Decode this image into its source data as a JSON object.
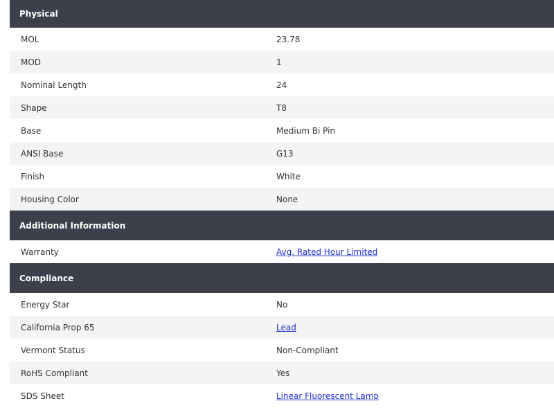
{
  "sections": [
    {
      "title": "Physical",
      "rows": [
        {
          "label": "MOL",
          "value": "23.78"
        },
        {
          "label": "MOD",
          "value": "1"
        },
        {
          "label": "Nominal Length",
          "value": "24"
        },
        {
          "label": "Shape",
          "value": "T8"
        },
        {
          "label": "Base",
          "value": "Medium Bi Pin"
        },
        {
          "label": "ANSI Base",
          "value": "G13"
        },
        {
          "label": "Finish",
          "value": "White"
        },
        {
          "label": "Housing Color",
          "value": "None"
        }
      ]
    },
    {
      "title": "Additional Information",
      "rows": [
        {
          "label": "Warranty",
          "value": "Avg. Rated Hour Limited",
          "link": true
        }
      ]
    },
    {
      "title": "Compliance",
      "rows": [
        {
          "label": "Energy Star",
          "value": "No"
        },
        {
          "label": "California Prop 65",
          "value": "Lead",
          "link": true
        },
        {
          "label": "Vermont Status",
          "value": "Non-Compliant"
        },
        {
          "label": "RoHS Compliant",
          "value": "Yes"
        },
        {
          "label": "SDS Sheet",
          "value": "Linear Fluorescent Lamp",
          "link": true
        }
      ]
    }
  ],
  "colors": {
    "header_bg": "#3d404b",
    "row_alt_bg": "#f4f4f4",
    "link": "#1a2fcc"
  }
}
